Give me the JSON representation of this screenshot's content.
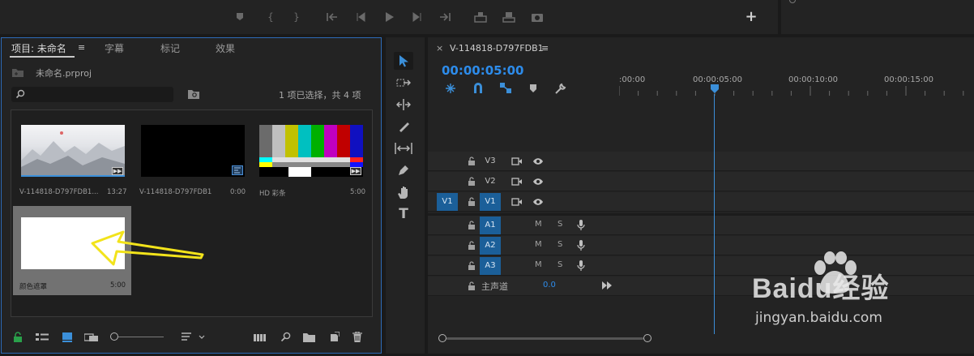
{
  "transport_bar": {
    "icons": [
      "marker-icon",
      "mark-in-icon",
      "mark-out-icon",
      "go-to-in-icon",
      "step-back-icon",
      "play-icon",
      "step-forward-icon",
      "go-to-out-icon",
      "insert-icon",
      "overwrite-icon",
      "export-frame-icon",
      "add-button-icon"
    ],
    "add_label": "+"
  },
  "project": {
    "tabs": [
      {
        "label": "项目: 未命名"
      },
      {
        "label": "字幕"
      },
      {
        "label": "标记"
      },
      {
        "label": "效果"
      }
    ],
    "menu_glyph": "≡",
    "file_name": "未命名.prproj",
    "search_placeholder": "",
    "selection_status": "1 项已选择，共 4 项",
    "items": [
      {
        "name": "V-114818-D797FDB1...",
        "duration": "13:27"
      },
      {
        "name": "V-114818-D797FDB1",
        "duration": "0:00"
      },
      {
        "name": "HD 彩条",
        "duration": "5:00"
      },
      {
        "name": "颜色遮罩",
        "duration": "5:00"
      }
    ]
  },
  "timeline": {
    "sequence_name": "V-114818-D797FDB1",
    "close_glyph": "×",
    "menu_glyph": "≡",
    "timecode": "00:00:05:00",
    "ruler": [
      ":00:00",
      "00:00:05:00",
      "00:00:10:00",
      "00:00:15:00"
    ],
    "video_tracks": [
      {
        "label": "V3",
        "source": "",
        "targeted": false
      },
      {
        "label": "V2",
        "source": "",
        "targeted": false
      },
      {
        "label": "V1",
        "source": "V1",
        "targeted": true
      }
    ],
    "audio_tracks": [
      {
        "label": "A1",
        "m": "M",
        "s": "S"
      },
      {
        "label": "A2",
        "m": "M",
        "s": "S"
      },
      {
        "label": "A3",
        "m": "M",
        "s": "S"
      }
    ],
    "master": {
      "label": "主声道",
      "value": "0.0"
    }
  },
  "colors": {
    "accent_blue": "#2d8ceb",
    "track_target": "#1b5f99",
    "arrow": "#f2e31b",
    "panel_bg": "#232323"
  },
  "watermark": {
    "text": "Baidu经验",
    "url": "jingyan.baidu.com"
  }
}
